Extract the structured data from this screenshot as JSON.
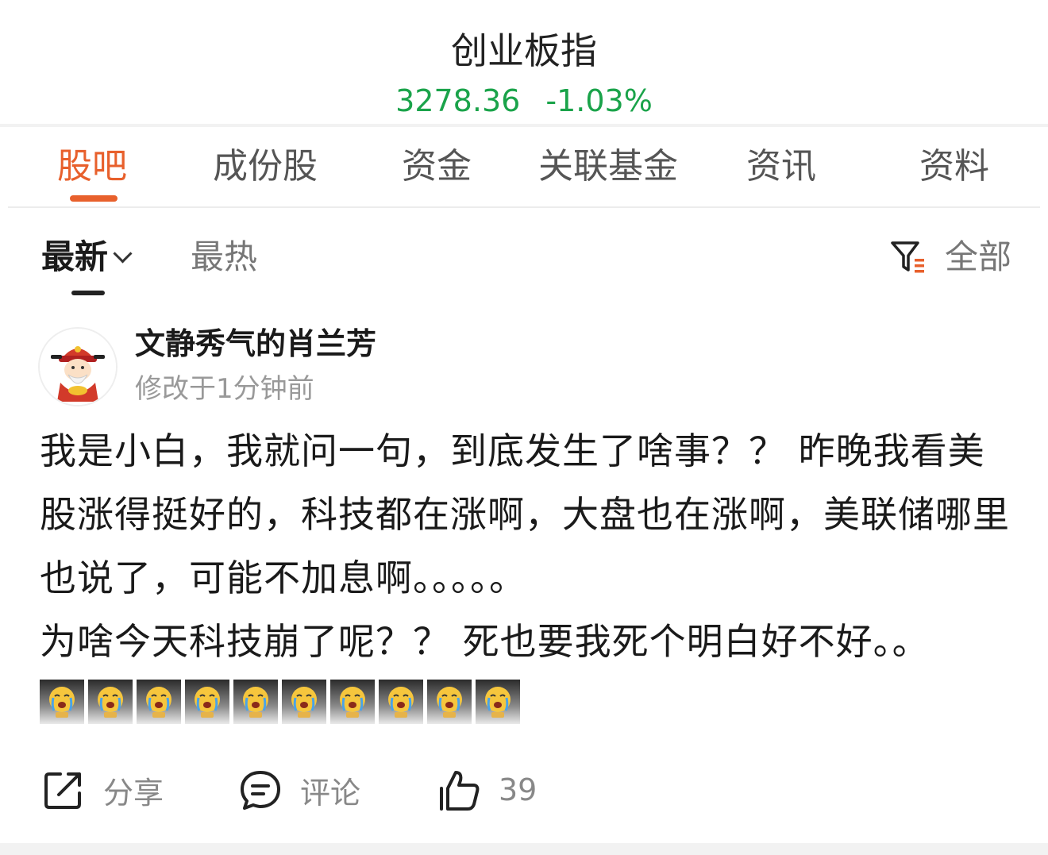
{
  "header": {
    "title": "创业板指",
    "price": "3278.36",
    "change": "-1.03%",
    "quote_color": "#1aa34a"
  },
  "tabs": [
    {
      "label": "股吧",
      "active": true
    },
    {
      "label": "成份股"
    },
    {
      "label": "资金"
    },
    {
      "label": "关联基金"
    },
    {
      "label": "资讯"
    },
    {
      "label": "资料"
    }
  ],
  "sort": {
    "newest": "最新",
    "hot": "最热",
    "filter_label": "全部"
  },
  "post": {
    "username": "文静秀气的肖兰芳",
    "time": "修改于1分钟前",
    "lines": [
      "我是小白，我就问一句，到底发生了啥事？？ 昨晚我看美股涨得挺好的，科技都在涨啊，大盘也在涨啊，美联储哪里也说了，可能不加息啊。。。。。",
      "为啥今天科技崩了呢？？ 死也要我死个明白好不好。。"
    ],
    "emoji_count": 10,
    "emoji_name": "crying-emoji"
  },
  "actions": {
    "share": "分享",
    "comment": "评论",
    "like_count": "39"
  },
  "accent_color": "#e8602c"
}
